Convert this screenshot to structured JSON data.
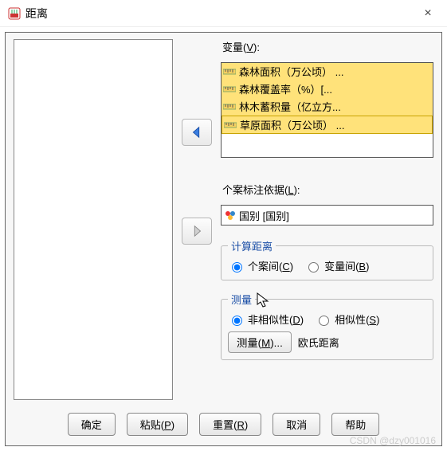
{
  "window": {
    "title": "距离",
    "close": "×"
  },
  "variables": {
    "label_prefix": "变量(",
    "label_mnemonic": "V",
    "label_suffix": "):",
    "items": [
      "森林面积（万公顷） ...",
      "森林覆盖率（%）[...",
      "林木蓄积量（亿立方...",
      "草原面积（万公顷） ..."
    ]
  },
  "case_label": {
    "label_prefix": "个案标注依据(",
    "label_mnemonic": "L",
    "label_suffix": "):",
    "value": "国别 [国别]"
  },
  "compute": {
    "legend": "计算距离",
    "opt1_prefix": "个案间(",
    "opt1_mn": "C",
    "opt1_suffix": ")",
    "opt2_prefix": "变量间(",
    "opt2_mn": "B",
    "opt2_suffix": ")",
    "selected": "case"
  },
  "measure": {
    "legend": "测量",
    "opt1_prefix": "非相似性(",
    "opt1_mn": "D",
    "opt1_suffix": ")",
    "opt2_prefix": "相似性(",
    "opt2_mn": "S",
    "opt2_suffix": ")",
    "selected": "dissim",
    "button_prefix": "测量(",
    "button_mn": "M",
    "button_suffix": ")...",
    "method": "欧氏距离"
  },
  "buttons": {
    "ok": "确定",
    "paste_prefix": "粘贴(",
    "paste_mn": "P",
    "paste_suffix": ")",
    "reset_prefix": "重置(",
    "reset_mn": "R",
    "reset_suffix": ")",
    "cancel": "取消",
    "help": "帮助"
  },
  "watermark": "CSDN @dzy001016"
}
